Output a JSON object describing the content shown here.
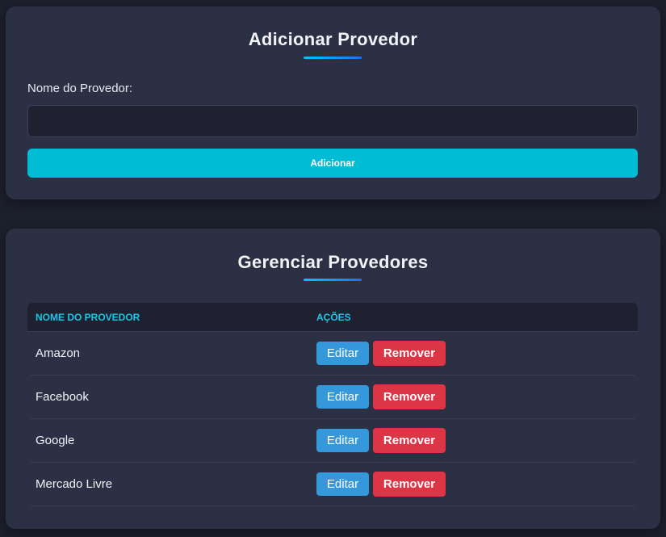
{
  "add_section": {
    "title": "Adicionar Provedor",
    "field_label": "Nome do Provedor:",
    "input_value": "",
    "input_placeholder": "",
    "submit_label": "Adicionar"
  },
  "manage_section": {
    "title": "Gerenciar Provedores",
    "columns": [
      "NOME DO PROVEDOR",
      "AÇÕES"
    ],
    "edit_label": "Editar",
    "remove_label": "Remover",
    "rows": [
      {
        "name": "Amazon"
      },
      {
        "name": "Facebook"
      },
      {
        "name": "Google"
      },
      {
        "name": "Mercado Livre"
      }
    ]
  },
  "colors": {
    "background": "#1c1f2c",
    "card": "#2c3045",
    "accent": "#00bcd4",
    "header_text": "#18c8e6",
    "edit": "#3498db",
    "remove": "#dc3545"
  }
}
